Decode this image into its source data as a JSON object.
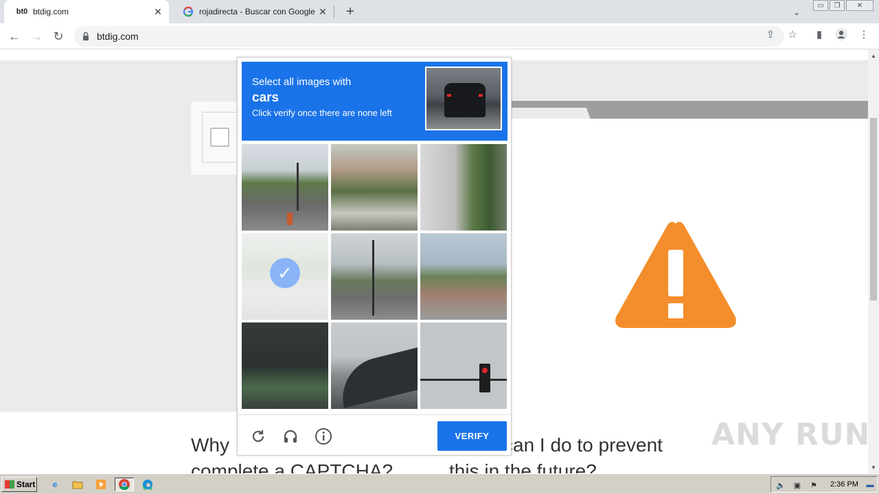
{
  "browser": {
    "tabs": [
      {
        "title": "btdig.com",
        "favicon": "bt0"
      },
      {
        "title": "rojadirecta - Buscar con Google",
        "favicon": "G"
      }
    ],
    "url": "btdig.com"
  },
  "captcha": {
    "instruction_line1": "Select all images with",
    "target": "cars",
    "instruction_line3": "Click verify once there are none left",
    "verify_label": "VERIFY",
    "selected_tiles": [
      3
    ]
  },
  "page": {
    "faq_left_line1": "Why",
    "faq_left_line2": "complete a CAPTCHA?",
    "faq_right_line1": "can I do to prevent",
    "faq_right_line2": "this in the future?",
    "warning_color": "#f48e2c"
  },
  "watermark": "ANY RUN",
  "taskbar": {
    "start_label": "Start",
    "clock": "2:36 PM"
  }
}
